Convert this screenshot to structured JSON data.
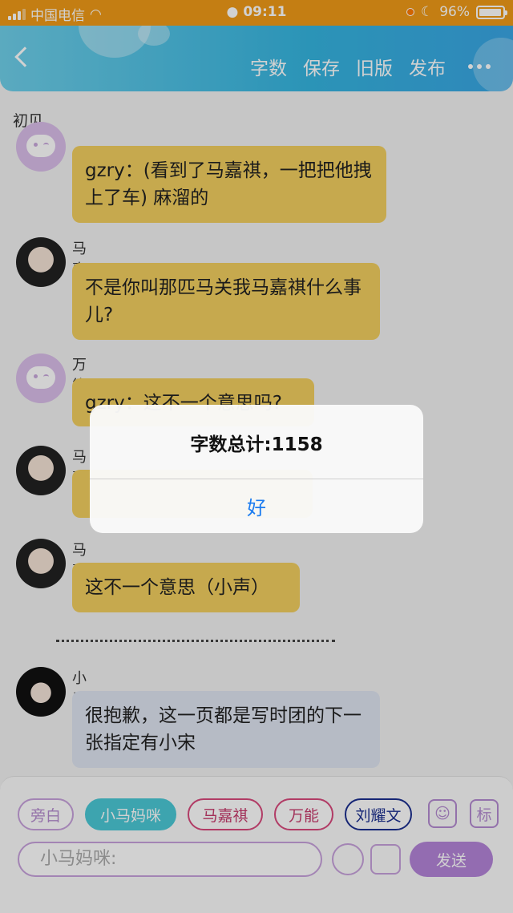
{
  "status_bar": {
    "carrier": "中国电信",
    "time": "09:11",
    "battery": "96%",
    "battery_level": 0.96
  },
  "header": {
    "actions": [
      "字数",
      "保存",
      "旧版",
      "发布"
    ]
  },
  "scene_title": "初见",
  "messages": [
    {
      "speaker": "",
      "text": "gzry：(看到了马嘉祺，一把把他拽上了车) 麻溜的"
    },
    {
      "speaker": "马嘉祺",
      "text": "不是你叫那匹马关我马嘉祺什么事儿?"
    },
    {
      "speaker": "万能",
      "text": "gzry：这不一个意思吗?"
    },
    {
      "speaker": "马嘉祺",
      "text": ""
    },
    {
      "speaker": "马嘉祺",
      "text": "这不一个意思（小声）"
    },
    {
      "speaker": "小马妈咪",
      "text": "很抱歉，这一页都是写时团的下一张指定有小宋"
    }
  ],
  "character_chips": [
    "旁白",
    "小马妈咪",
    "马嘉祺",
    "万能",
    "刘耀文"
  ],
  "side_buttons": {
    "mark_label": "标"
  },
  "input": {
    "placeholder": "小马妈咪:"
  },
  "send_label": "发送",
  "dialog": {
    "title": "字数总计:1158",
    "ok_label": "好"
  },
  "colors": {
    "status_bar": "#ef9a18",
    "bubble": "#f2cf60",
    "send": "#b484d8",
    "dialog_link": "#1c7cf0"
  }
}
